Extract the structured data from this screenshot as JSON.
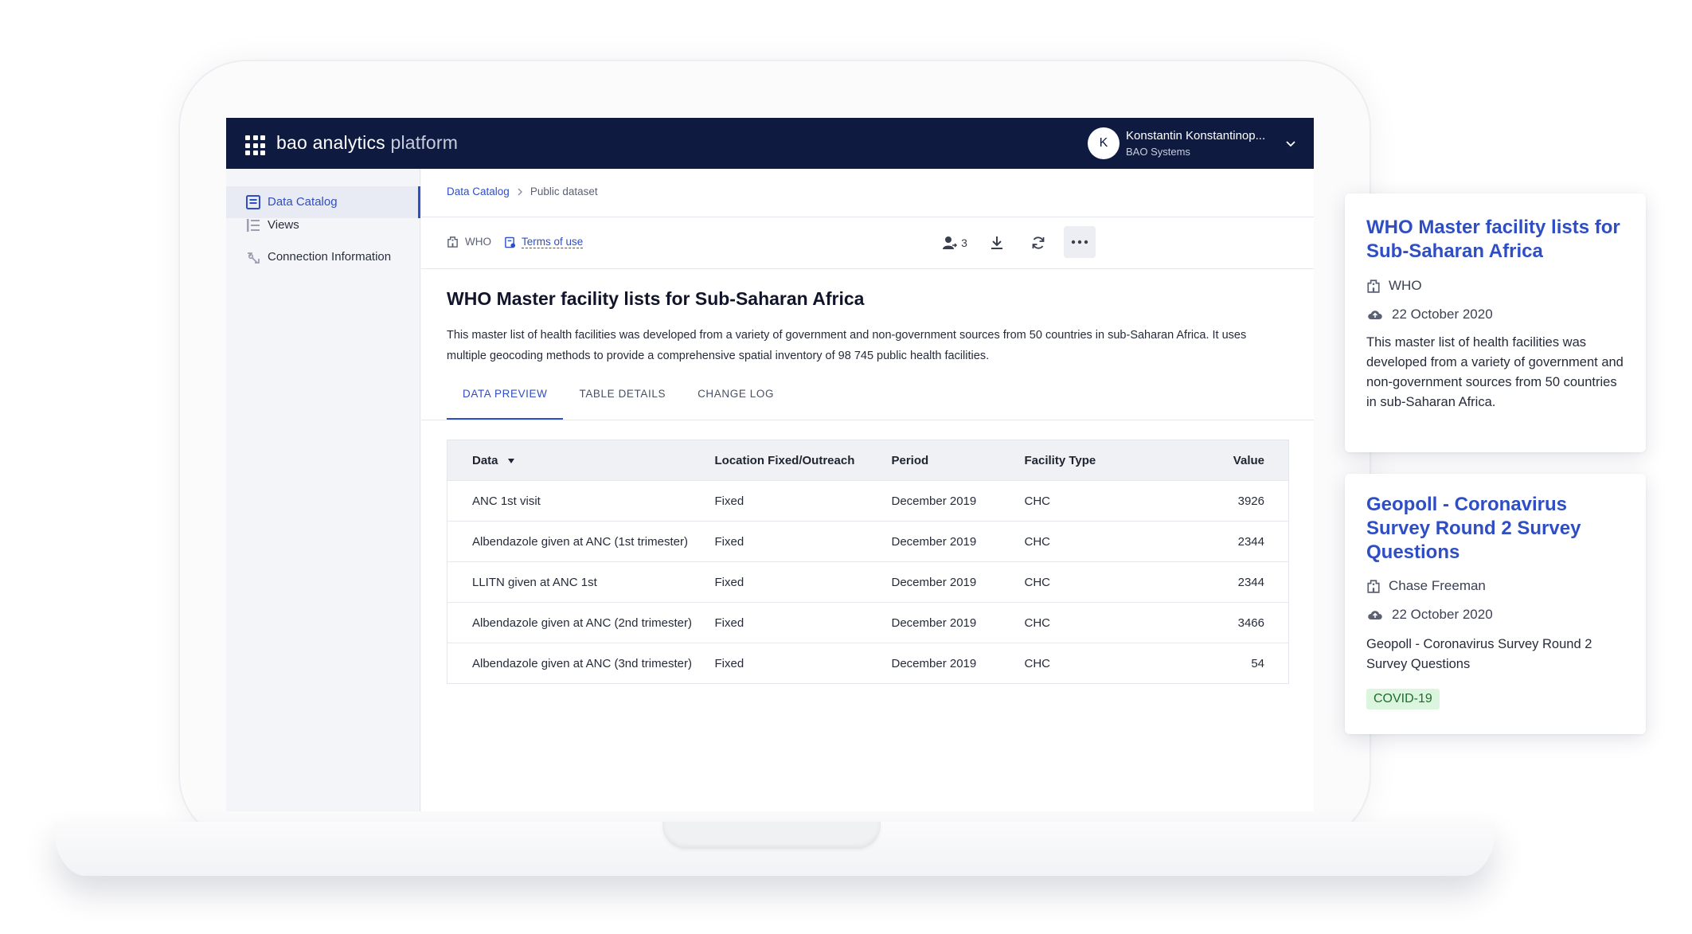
{
  "app": {
    "brand_main": "bao analytics",
    "brand_sub": "platform",
    "user_initial": "K",
    "user_name": "Konstantin Konstantinop...",
    "user_org": "BAO Systems"
  },
  "sidebar": {
    "items": [
      {
        "label": "Data Catalog",
        "icon": "catalog-icon",
        "active": true
      },
      {
        "label": "Views",
        "icon": "list-icon",
        "active": false
      },
      {
        "label": "Connection Information",
        "icon": "connection-icon",
        "active": false
      }
    ]
  },
  "breadcrumb": {
    "root": "Data Catalog",
    "current": "Public dataset"
  },
  "toolbar": {
    "publisher": "WHO",
    "terms_label": "Terms of use",
    "users_count": "3"
  },
  "dataset": {
    "title": "WHO Master facility lists for Sub-Saharan Africa",
    "description": "This master list of health facilities was developed from a variety of government and non-government sources from 50 countries in sub-Saharan Africa. It uses multiple geocoding methods to provide a comprehensive spatial inventory of 98 745 public health facilities."
  },
  "tabs": [
    {
      "label": "DATA PREVIEW",
      "active": true
    },
    {
      "label": "TABLE DETAILS",
      "active": false
    },
    {
      "label": "CHANGE LOG",
      "active": false
    }
  ],
  "table": {
    "headers": [
      "Data",
      "Location Fixed/Outreach",
      "Period",
      "Facility Type",
      "Value"
    ],
    "rows": [
      [
        "ANC 1st visit",
        "Fixed",
        "December 2019",
        "CHC",
        "3926"
      ],
      [
        "Albendazole given at ANC (1st trimester)",
        "Fixed",
        "December 2019",
        "CHC",
        "2344"
      ],
      [
        "LLITN given at ANC 1st",
        "Fixed",
        "December 2019",
        "CHC",
        "2344"
      ],
      [
        "Albendazole given at ANC (2nd trimester)",
        "Fixed",
        "December 2019",
        "CHC",
        "3466"
      ],
      [
        "Albendazole given at ANC (3nd trimester)",
        "Fixed",
        "December 2019",
        "CHC",
        "54"
      ]
    ]
  },
  "cards": [
    {
      "title": "WHO Master facility lists for Sub-Saharan Africa",
      "publisher": "WHO",
      "date": "22 October 2020",
      "description": "This master list of health facilities was developed from a variety of government and non-government sources from 50 countries in sub-Saharan Africa."
    },
    {
      "title": "Geopoll - Coronavirus Survey Round 2 Survey Questions",
      "publisher": "Chase Freeman",
      "date": "22 October 2020",
      "description": "Geopoll - Coronavirus Survey Round 2 Survey Questions",
      "tag": "COVID-19"
    }
  ],
  "colors": {
    "topbar": "#0e1a3f",
    "accent": "#2f4ec4",
    "tag_bg": "#dcf5de"
  }
}
